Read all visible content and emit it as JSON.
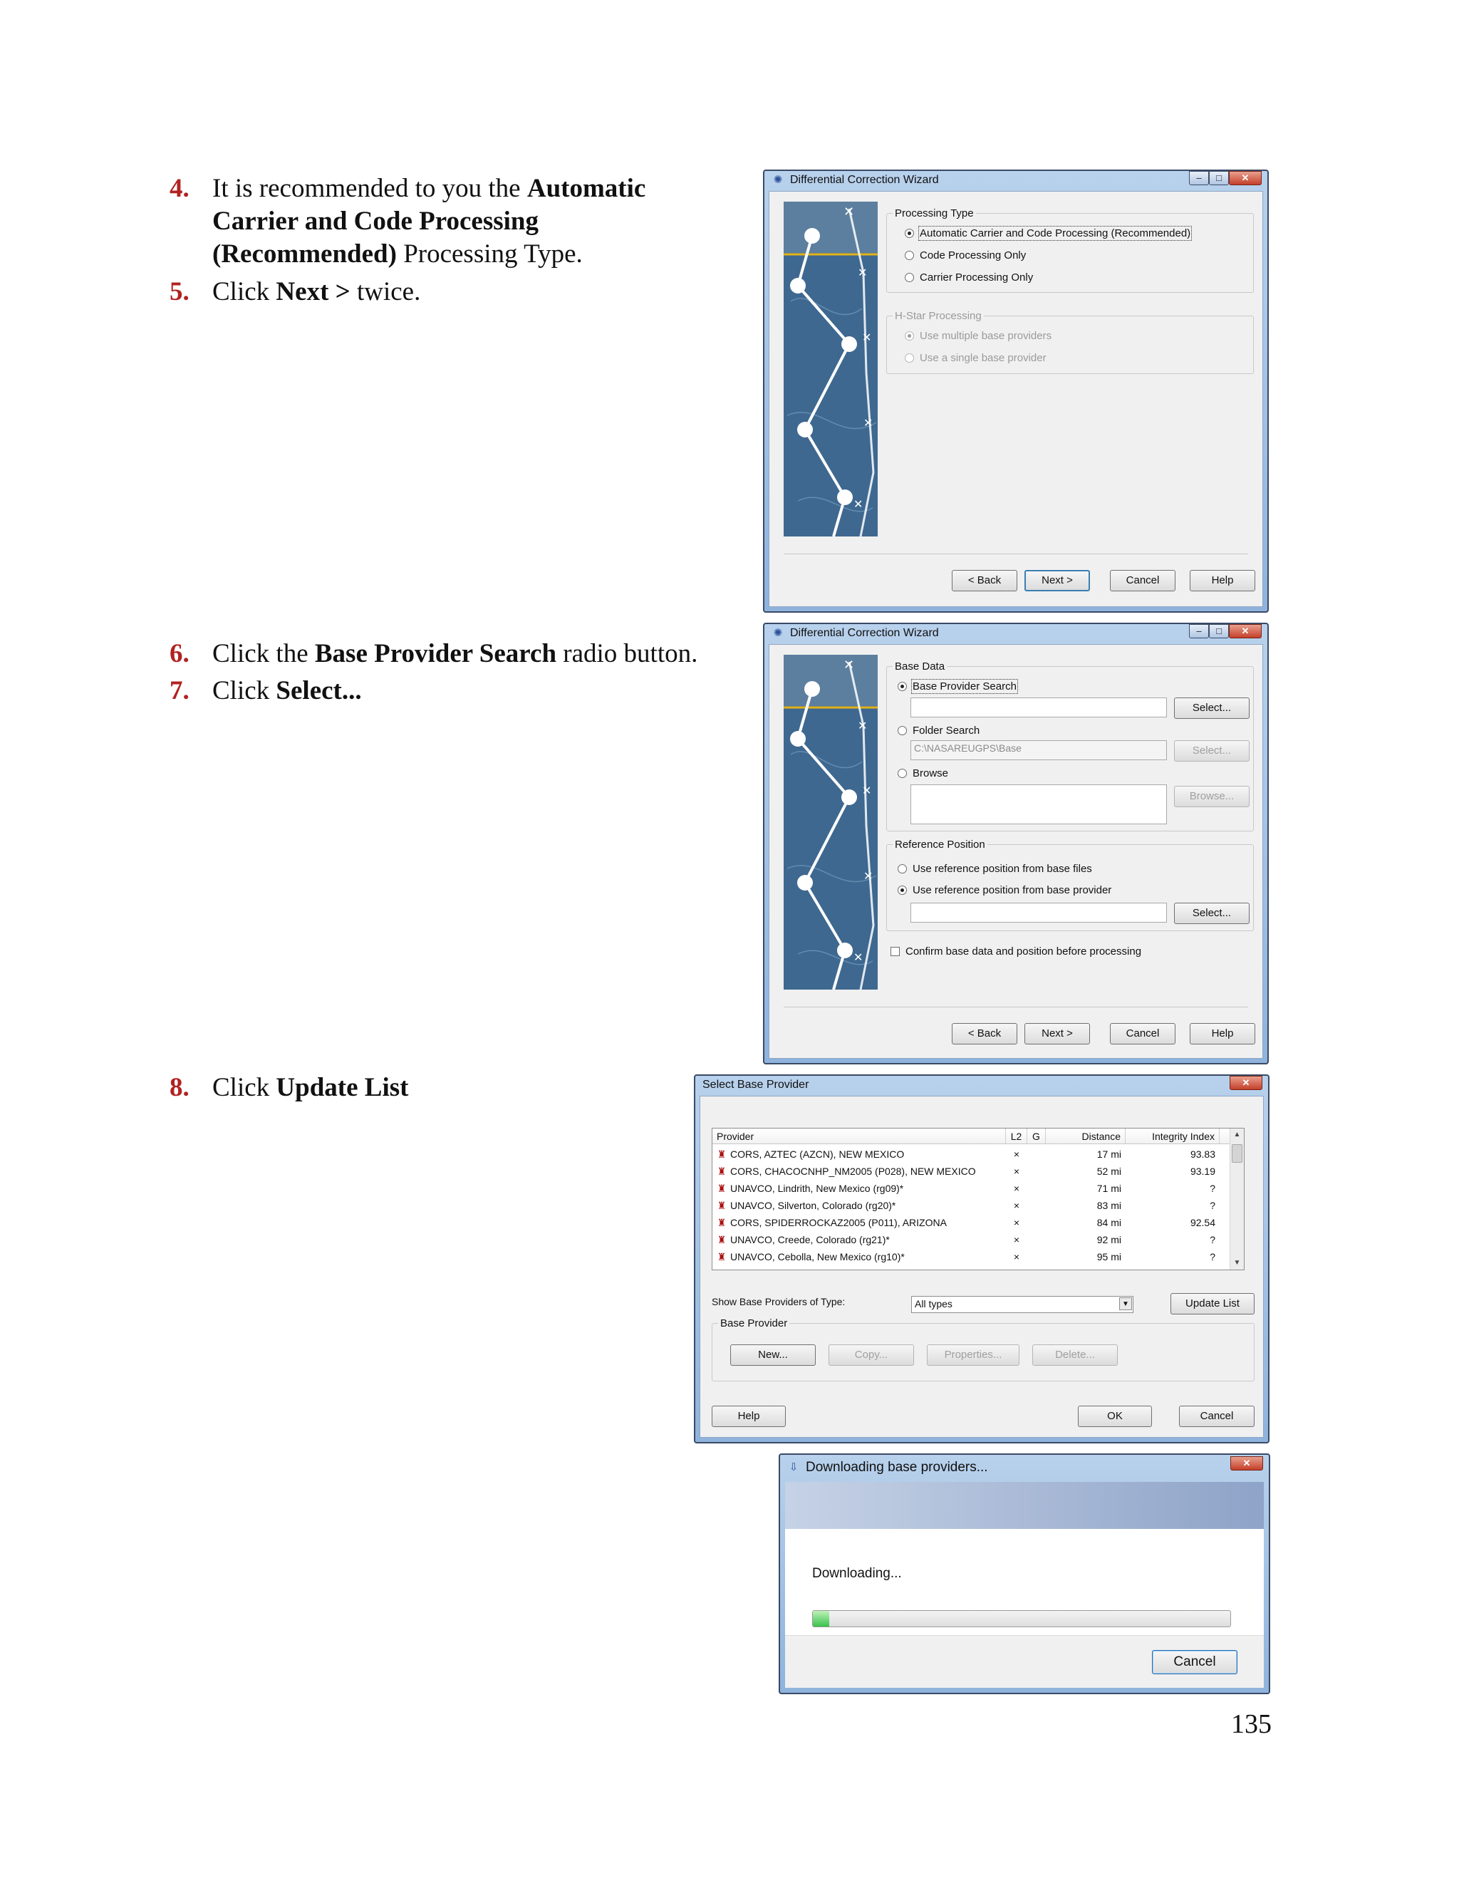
{
  "steps": [
    {
      "num": "4.",
      "pre": "It is recommended to you the ",
      "bold": "Automatic Carrier and Code Processing (Recommended)",
      "post": " Processing Type."
    },
    {
      "num": "5.",
      "pre": "Click ",
      "bold": "Next >",
      "post": " twice."
    },
    {
      "num": "6.",
      "pre": "Click the ",
      "bold": "Base Provider Search",
      "post": " radio button."
    },
    {
      "num": "7.",
      "pre": "Click ",
      "bold": "Select...",
      "post": ""
    },
    {
      "num": "8.",
      "pre": "Click ",
      "bold": "Update List",
      "post": ""
    }
  ],
  "page_number": "135",
  "window_controls": {
    "min": "–",
    "max": "□",
    "close": "✕"
  },
  "wizard1": {
    "title": "Differential Correction Wizard",
    "processing_type": {
      "legend": "Processing Type",
      "options": [
        "Automatic Carrier and Code Processing (Recommended)",
        "Code Processing Only",
        "Carrier Processing Only"
      ]
    },
    "hstar": {
      "legend": "H-Star Processing",
      "options": [
        "Use multiple base providers",
        "Use a single base provider"
      ]
    },
    "buttons": {
      "back": "< Back",
      "next": "Next >",
      "cancel": "Cancel",
      "help": "Help"
    }
  },
  "wizard2": {
    "title": "Differential Correction Wizard",
    "base_data": {
      "legend": "Base Data",
      "base_provider_search": "Base Provider Search",
      "folder_search": "Folder Search",
      "folder_path": "C:\\NASAREUGPS\\Base",
      "browse": "Browse",
      "select": "Select...",
      "browse_btn": "Browse..."
    },
    "reference_position": {
      "legend": "Reference Position",
      "from_files": "Use reference position from base files",
      "from_provider": "Use reference position from base provider",
      "select": "Select..."
    },
    "confirm": "Confirm base data and position before processing",
    "buttons": {
      "back": "< Back",
      "next": "Next >",
      "cancel": "Cancel",
      "help": "Help"
    }
  },
  "select_provider": {
    "title": "Select Base Provider",
    "columns": [
      "Provider",
      "L2",
      "G",
      "Distance",
      "Integrity Index"
    ],
    "rows": [
      {
        "provider": "CORS, AZTEC (AZCN),  NEW MEXICO",
        "l2": "×",
        "g": "",
        "distance": "17 mi",
        "integrity": "93.83"
      },
      {
        "provider": "CORS, CHACOCNHP_NM2005 (P028),  NEW MEXICO",
        "l2": "×",
        "g": "",
        "distance": "52 mi",
        "integrity": "93.19"
      },
      {
        "provider": "UNAVCO, Lindrith, New Mexico (rg09)*",
        "l2": "×",
        "g": "",
        "distance": "71 mi",
        "integrity": "?"
      },
      {
        "provider": "UNAVCO, Silverton, Colorado (rg20)*",
        "l2": "×",
        "g": "",
        "distance": "83 mi",
        "integrity": "?"
      },
      {
        "provider": "CORS, SPIDERROCKAZ2005 (P011),  ARIZONA",
        "l2": "×",
        "g": "",
        "distance": "84 mi",
        "integrity": "92.54"
      },
      {
        "provider": "UNAVCO, Creede, Colorado (rg21)*",
        "l2": "×",
        "g": "",
        "distance": "92 mi",
        "integrity": "?"
      },
      {
        "provider": "UNAVCO, Cebolla, New Mexico (rg10)*",
        "l2": "×",
        "g": "",
        "distance": "95 mi",
        "integrity": "?"
      }
    ],
    "show_types_label": "Show Base Providers of Type:",
    "type_value": "All types",
    "update_list": "Update List",
    "base_provider_legend": "Base Provider",
    "new": "New...",
    "copy": "Copy...",
    "properties": "Properties...",
    "delete": "Delete...",
    "help": "Help",
    "ok": "OK",
    "cancel": "Cancel"
  },
  "downloading": {
    "title": "Downloading base providers...",
    "status": "Downloading...",
    "progress": 0.04,
    "cancel": "Cancel"
  },
  "colors": {
    "step_number": "#b22222",
    "progress_fill": "#38c24b",
    "window_frame": "#8fb3dc"
  }
}
